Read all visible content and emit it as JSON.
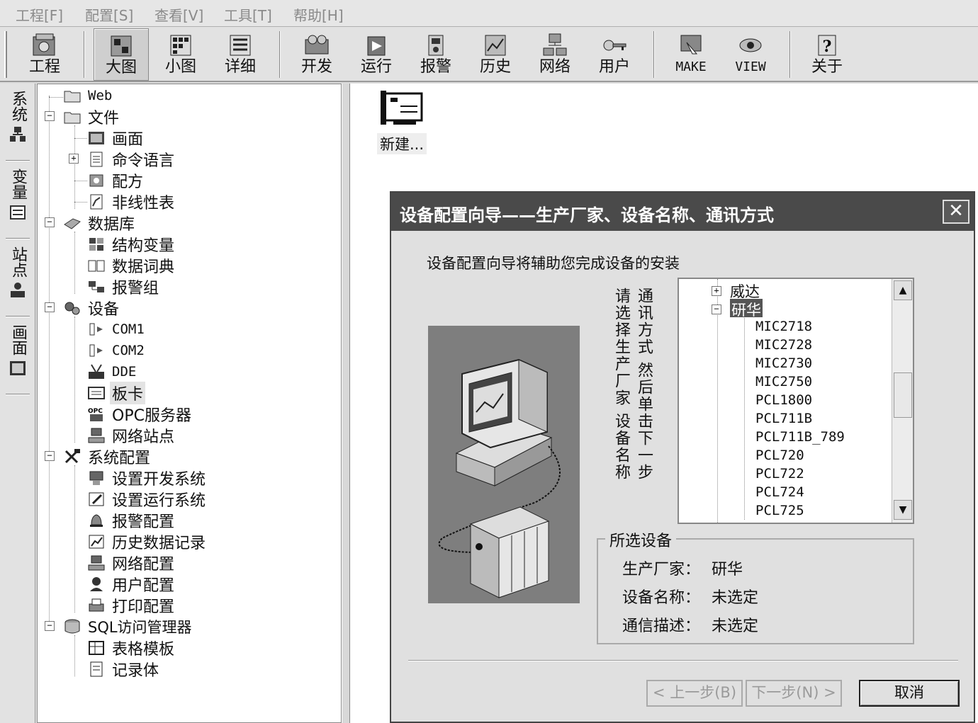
{
  "menu": {
    "items": [
      "工程[F]",
      "配置[S]",
      "查看[V]",
      "工具[T]",
      "帮助[H]"
    ]
  },
  "toolbar": {
    "items": [
      {
        "label": "工程",
        "icon": "project-icon"
      },
      {
        "label": "大图",
        "icon": "large-icons-icon"
      },
      {
        "label": "小图",
        "icon": "small-icons-icon"
      },
      {
        "label": "详细",
        "icon": "details-icon"
      },
      {
        "label": "开发",
        "icon": "develop-icon"
      },
      {
        "label": "运行",
        "icon": "run-icon"
      },
      {
        "label": "报警",
        "icon": "alarm-icon"
      },
      {
        "label": "历史",
        "icon": "history-icon"
      },
      {
        "label": "网络",
        "icon": "network-icon"
      },
      {
        "label": "用户",
        "icon": "user-key-icon"
      },
      {
        "label": "MAKE",
        "icon": "make-icon"
      },
      {
        "label": "VIEW",
        "icon": "view-icon"
      },
      {
        "label": "关于",
        "icon": "about-icon"
      }
    ]
  },
  "side_tabs": [
    "系统",
    "变量",
    "站点",
    "画面"
  ],
  "tree": {
    "web": "Web",
    "file": "文件",
    "picture": "画面",
    "command_lang": "命令语言",
    "recipe": "配方",
    "nonlinear": "非线性表",
    "database": "数据库",
    "struct_var": "结构变量",
    "data_dict": "数据词典",
    "alarm_group": "报警组",
    "device": "设备",
    "com1": "COM1",
    "com2": "COM2",
    "dde": "DDE",
    "board": "板卡",
    "opc": "OPC服务器",
    "net_station": "网络站点",
    "sys_config": "系统配置",
    "dev_sys": "设置开发系统",
    "run_sys": "设置运行系统",
    "alarm_cfg": "报警配置",
    "hist_rec": "历史数据记录",
    "net_cfg": "网络配置",
    "user_cfg": "用户配置",
    "print_cfg": "打印配置",
    "sql": "SQL访问管理器",
    "table_tpl": "表格模板",
    "record": "记录体"
  },
  "workspace": {
    "new_label": "新建..."
  },
  "dialog": {
    "title": "设备配置向导——生产厂家、设备名称、通讯方式",
    "close": "✕",
    "intro": "设备配置向导将辅助您完成设备的安装",
    "instr_right": "通讯方式 然后单击下一步",
    "instr_left": "请选择生产厂家 设备名称",
    "list": {
      "weida": "威达",
      "yanhua": "研华",
      "items": [
        "MIC2718",
        "MIC2728",
        "MIC2730",
        "MIC2750",
        "PCL1800",
        "PCL711B",
        "PCL711B_789",
        "PCL720",
        "PCL722",
        "PCL724",
        "PCL725"
      ]
    },
    "selected": {
      "legend": "所选设备",
      "mfr_label": "生产厂家：",
      "mfr_value": "研华",
      "name_label": "设备名称：",
      "name_value": "未选定",
      "comm_label": "通信描述：",
      "comm_value": "未选定"
    },
    "buttons": {
      "prev": "< 上一步(B)",
      "next": "下一步(N) >",
      "cancel": "取消"
    }
  }
}
